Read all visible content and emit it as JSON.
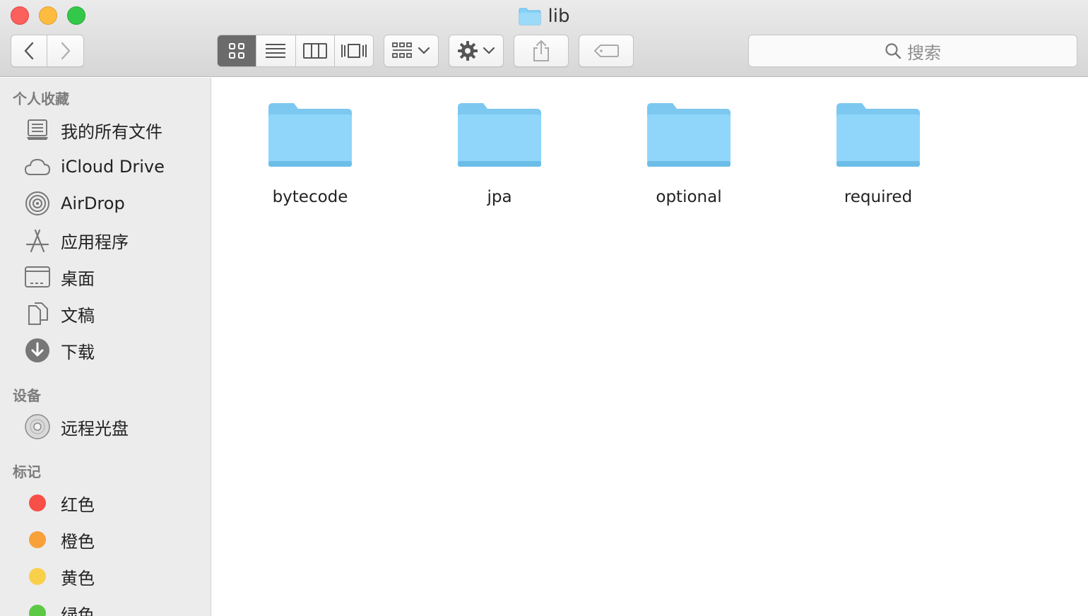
{
  "window": {
    "title": "lib",
    "folder_color": "#86d1f7"
  },
  "toolbar": {
    "back_icon": "chevron-left-icon",
    "forward_icon": "chevron-right-icon",
    "view_modes": [
      "icon-view",
      "list-view",
      "column-view",
      "cover-flow-view"
    ],
    "active_view": "icon-view",
    "group_icon": "group-by-icon",
    "action_icon": "gear-icon",
    "share_icon": "share-icon",
    "tag_icon": "tag-icon",
    "search_placeholder": "搜索"
  },
  "sidebar": {
    "favorites_header": "个人收藏",
    "favorites": [
      {
        "label": "我的所有文件",
        "icon": "all-files-icon"
      },
      {
        "label": "iCloud Drive",
        "icon": "cloud-icon"
      },
      {
        "label": "AirDrop",
        "icon": "airdrop-icon"
      },
      {
        "label": "应用程序",
        "icon": "applications-icon"
      },
      {
        "label": "桌面",
        "icon": "desktop-icon"
      },
      {
        "label": "文稿",
        "icon": "documents-icon"
      },
      {
        "label": "下载",
        "icon": "downloads-icon"
      }
    ],
    "devices_header": "设备",
    "devices": [
      {
        "label": "远程光盘",
        "icon": "disc-icon"
      }
    ],
    "tags_header": "标记",
    "tags": [
      {
        "label": "红色",
        "color": "#f84f48"
      },
      {
        "label": "橙色",
        "color": "#f8a03a"
      },
      {
        "label": "黄色",
        "color": "#f9d04a"
      },
      {
        "label": "绿色",
        "color": "#5cc945"
      }
    ]
  },
  "content": {
    "items": [
      {
        "name": "bytecode",
        "type": "folder"
      },
      {
        "name": "jpa",
        "type": "folder"
      },
      {
        "name": "optional",
        "type": "folder"
      },
      {
        "name": "required",
        "type": "folder"
      }
    ]
  }
}
